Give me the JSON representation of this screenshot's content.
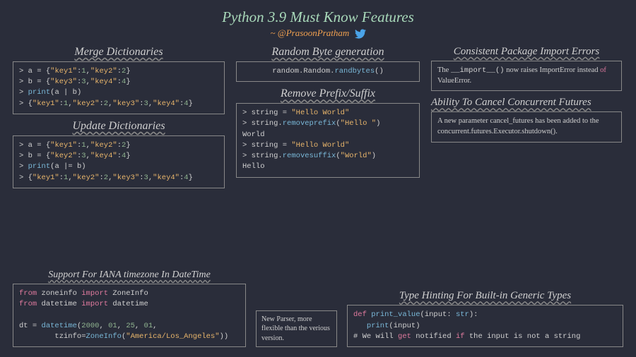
{
  "title": "Python 3.9 Must Know Features",
  "author": "~ @PrasoonPratham",
  "sections": {
    "merge": {
      "title": "Merge Dictionaries",
      "code": "> a = {\"key1\":1,\"key2\":2}\n> b = {\"key3\":3,\"key4\":4}\n> print(a | b)\n> {\"key1\":1,\"key2\":2,\"key3\":3,\"key4\":4}"
    },
    "update": {
      "title": "Update Dictionaries",
      "code": "> a = {\"key1\":1,\"key2\":2}\n> b = {\"key2\":3,\"key4\":4}\n> print(a |= b)\n> {\"key1\":1,\"key2\":2,\"key3\":3,\"key4\":4}"
    },
    "iana": {
      "title": "Support For IANA timezone In DateTime",
      "code": "from zoneinfo import ZoneInfo\nfrom datetime import datetime\n\ndt = datetime(2000, 01, 25, 01,\n        tzinfo=ZoneInfo(\"America/Los_Angeles\"))"
    },
    "random": {
      "title": "Random Byte generation",
      "code": "random.Random.randbytes()"
    },
    "remove": {
      "title": "Remove Prefix/Suffix",
      "code": "> string = \"Hello World\"\n> string.removeprefix(\"Hello \")\nWorld\n> string = \"Hello World\"\n> string.removesuffix(\"World\")\nHello"
    },
    "parser": {
      "text": "New Parser, more flexible than the verious version."
    },
    "import": {
      "title": "Consistent Package Import Errors",
      "text_pre": "The ",
      "text_code1": "__import__()",
      "text_mid": " now raises ImportError instead ",
      "text_of": "of",
      "text_end": " ValueError."
    },
    "cancel": {
      "title": "Ability To Cancel Concurrent Futures",
      "text": "A new parameter cancel_futures has been added to the concurrent.futures.Executor.shutdown()."
    },
    "type": {
      "title": "Type Hinting For Built-in Generic Types",
      "code": "def print_value(input: str):\n   print(input)\n# We will get notified if the input is not a string"
    }
  }
}
